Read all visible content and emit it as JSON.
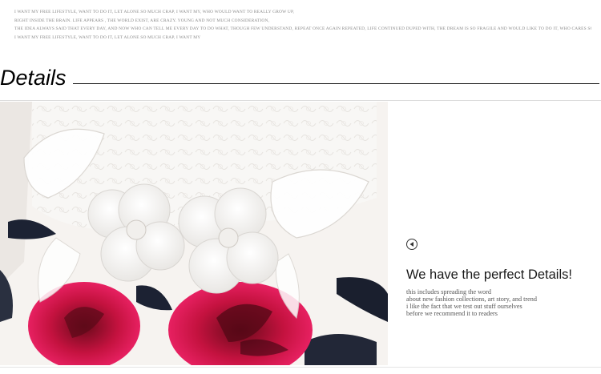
{
  "intro": {
    "lines": [
      "I WANT MY FREE LIFESTYLE, WANT TO DO IT, LET ALONE SO MUCH CRAP, I WANT MY, WHO WOULD WANT TO REALLY GROW UP,",
      "RIGHT INSIDE THE BRAIN. LIFE APPEARS , THE WORLD EXIST, ARE CRAZY. YOUNG AND NOT MUCH CONSIDERATION,",
      "THE IDEA ALWAYS SAID THAT EVERY DAY, AND NOW WHO CAN TELL ME EVERY DAY TO DO WHAT, THOUGH FEW UNDERSTAND, REPEAT ONCE AGAIN REPEATED, LIFE CONTINUED DUPED WITH, THE DREAM IS SO FRAGILE AND WOULD LIKE TO DO IT, WHO CARES SO MUCH,",
      "I WANT MY FREE LIFESTYLE, WANT TO DO IT, LET ALONE SO MUCH CRAP, I WANT MY"
    ]
  },
  "section": {
    "title": "Details"
  },
  "feature": {
    "headline": "We have the perfect Details!",
    "body_lines": [
      "this includes spreading the word",
      "about new fashion collections, art story, and trend",
      "i like the fact that we test out stuff  ourselves",
      "before we recommend it to readers"
    ],
    "arrow_icon": "left-arrow-circle-icon"
  },
  "colors": {
    "rose": "#e8185f",
    "rose_dark": "#7a0f20",
    "text": "#1a1a1a",
    "rule": "#111111"
  }
}
